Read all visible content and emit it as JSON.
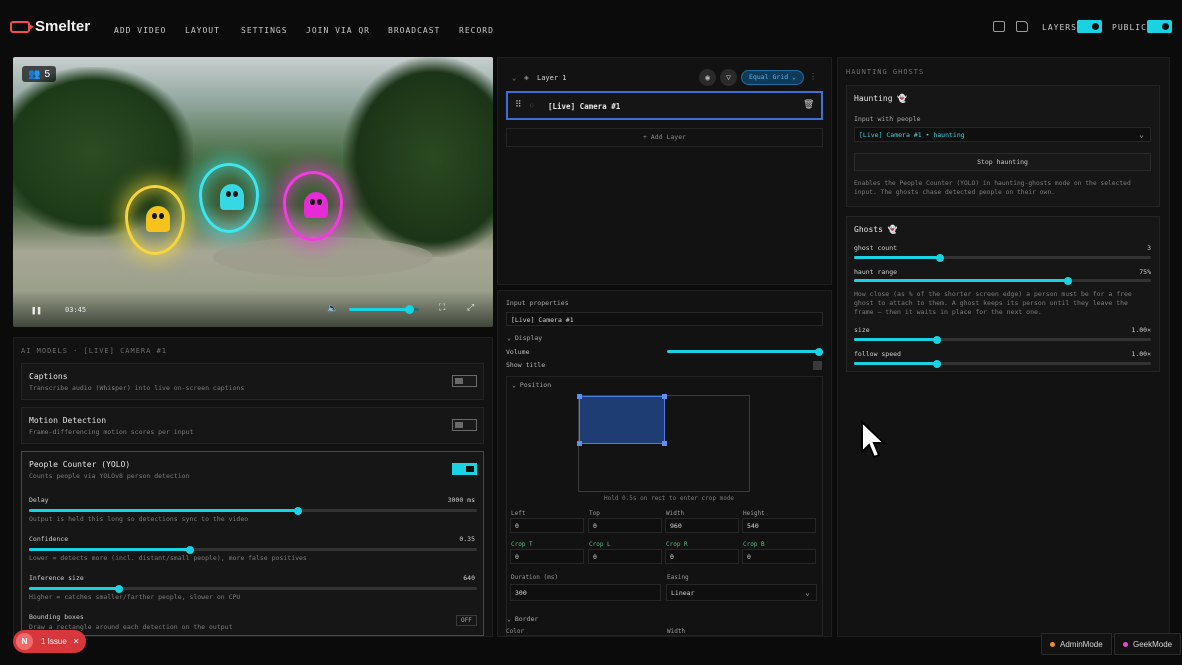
{
  "app": {
    "name": "Smelter"
  },
  "nav": [
    "ADD VIDEO",
    "LAYOUT",
    "SETTINGS",
    "JOIN VIA QR",
    "BROADCAST",
    "RECORD"
  ],
  "topright": {
    "layers_label": "LAYERS",
    "public_label": "PUBLIC"
  },
  "video": {
    "people_count": "5",
    "time": "03:45",
    "volume_level": 0.86
  },
  "ai": {
    "section_title": "AI MODELS · [LIVE] CAMERA #1",
    "captions": {
      "title": "Captions",
      "desc": "Transcribe audio (Whisper) into live on-screen captions",
      "enabled": false
    },
    "motion": {
      "title": "Motion Detection",
      "desc": "Frame-differencing motion scores per input",
      "enabled": false
    },
    "people": {
      "title": "People Counter (YOLO)",
      "desc": "Counts people via YOLOv8 person detection",
      "enabled": true,
      "delay": {
        "label": "Delay",
        "value": "3000 ms",
        "level": 0.6,
        "desc": "Output is held this long so detections sync to the video"
      },
      "confidence": {
        "label": "Confidence",
        "value": "0.35",
        "level": 0.36,
        "desc": "Lower = detects more (incl. distant/small people), more false positives"
      },
      "inference": {
        "label": "Inference size",
        "value": "640",
        "level": 0.2,
        "desc": "Higher = catches smaller/farther people, slower on CPU"
      },
      "bbox": {
        "label": "Bounding boxes",
        "desc": "Draw a rectangle around each detection on the output",
        "state": "OFF"
      }
    }
  },
  "layers": {
    "layer_name": "Layer 1",
    "layout_mode": "Equal Grid",
    "item": "[Live] Camera #1",
    "add_layer": "+ Add Layer"
  },
  "input_props": {
    "title": "Input properties",
    "name": "[Live] Camera #1",
    "display_label": "Display",
    "volume_label": "Volume",
    "volume_level": 1.0,
    "show_title_label": "Show title",
    "position_label": "Position",
    "hint": "Hold 0.5s on rect to enter crop mode",
    "fields": [
      {
        "label": "Left",
        "value": "0"
      },
      {
        "label": "Top",
        "value": "0"
      },
      {
        "label": "Width",
        "value": "960"
      },
      {
        "label": "Height",
        "value": "540"
      }
    ],
    "crop": [
      {
        "label": "Crop T",
        "value": "0"
      },
      {
        "label": "Crop L",
        "value": "0"
      },
      {
        "label": "Crop R",
        "value": "0"
      },
      {
        "label": "Crop B",
        "value": "0"
      }
    ],
    "duration_label": "Duration (ms)",
    "duration": "300",
    "easing_label": "Easing",
    "easing": "Linear",
    "border_label": "Border",
    "color_label": "Color",
    "width_label": "Width"
  },
  "haunting": {
    "section_title": "HAUNTING GHOSTS",
    "card_title": "Haunting 👻",
    "input_label": "Input with people",
    "selected_input": "[Live] Camera #1 • haunting",
    "stop_button": "Stop haunting",
    "desc": "Enables the People Counter (YOLO) in haunting-ghosts mode on the selected input. The ghosts chase detected people on their own."
  },
  "ghosts": {
    "card_title": "Ghosts 👻",
    "count": {
      "label": "ghost count",
      "value": "3",
      "level": 0.29
    },
    "range": {
      "label": "haunt range",
      "value": "75%",
      "level": 0.72,
      "desc": "How close (as % of the shorter screen edge) a person must be for a free ghost to attach to them. A ghost keeps its person until they leave the frame — then it waits in place for the next one."
    },
    "size": {
      "label": "size",
      "value": "1.00×",
      "level": 0.28
    },
    "speed": {
      "label": "follow speed",
      "value": "1.00×",
      "level": 0.28
    }
  },
  "footer": {
    "issue": "1 Issue",
    "issue_avatar": "N",
    "admin": "AdminMode",
    "geek": "GeekMode"
  },
  "colors": {
    "accent": "#19d3e3",
    "danger": "#d7363a",
    "admin_dot": "#f28b2b",
    "geek_dot": "#d94fd1"
  }
}
